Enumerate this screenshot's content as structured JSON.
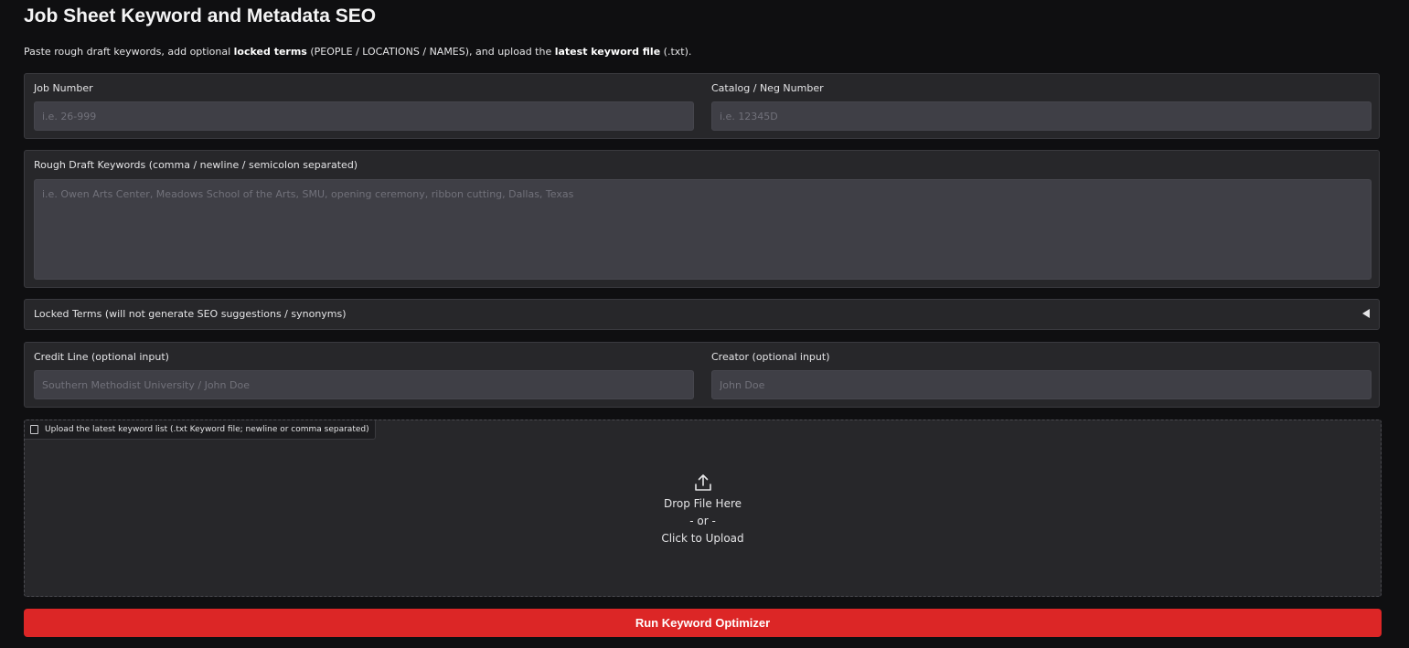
{
  "header": {
    "title": "Job Sheet Keyword and Metadata SEO",
    "subtitle_parts": {
      "p1": "Paste rough draft keywords, add optional ",
      "b1": "locked terms",
      "p2": " (PEOPLE / LOCATIONS / NAMES), and upload the ",
      "b2": "latest keyword file",
      "p3": " (.txt)."
    }
  },
  "job_number": {
    "label": "Job Number",
    "value": "",
    "placeholder": "i.e. 26-999"
  },
  "catalog_number": {
    "label": "Catalog / Neg Number",
    "value": "",
    "placeholder": "i.e. 12345D"
  },
  "rough_draft": {
    "label": "Rough Draft Keywords (comma / newline / semicolon separated)",
    "value": "",
    "placeholder": "i.e. Owen Arts Center, Meadows School of the Arts, SMU, opening ceremony, ribbon cutting, Dallas, Texas"
  },
  "locked_terms": {
    "label": "Locked Terms (will not generate SEO suggestions / synonyms)",
    "expanded": false
  },
  "credit_line": {
    "label": "Credit Line (optional input)",
    "value": "",
    "placeholder": "Southern Methodist University / John Doe"
  },
  "creator": {
    "label": "Creator (optional input)",
    "value": "",
    "placeholder": "John Doe"
  },
  "upload": {
    "label": "Upload the latest keyword list (.txt Keyword file; newline or comma separated)",
    "drop_text": "Drop File Here",
    "or_text": "- or -",
    "click_text": "Click to Upload",
    "icon": "upload-icon"
  },
  "run_button": {
    "label": "Run Keyword Optimizer",
    "color": "#dc2626"
  }
}
